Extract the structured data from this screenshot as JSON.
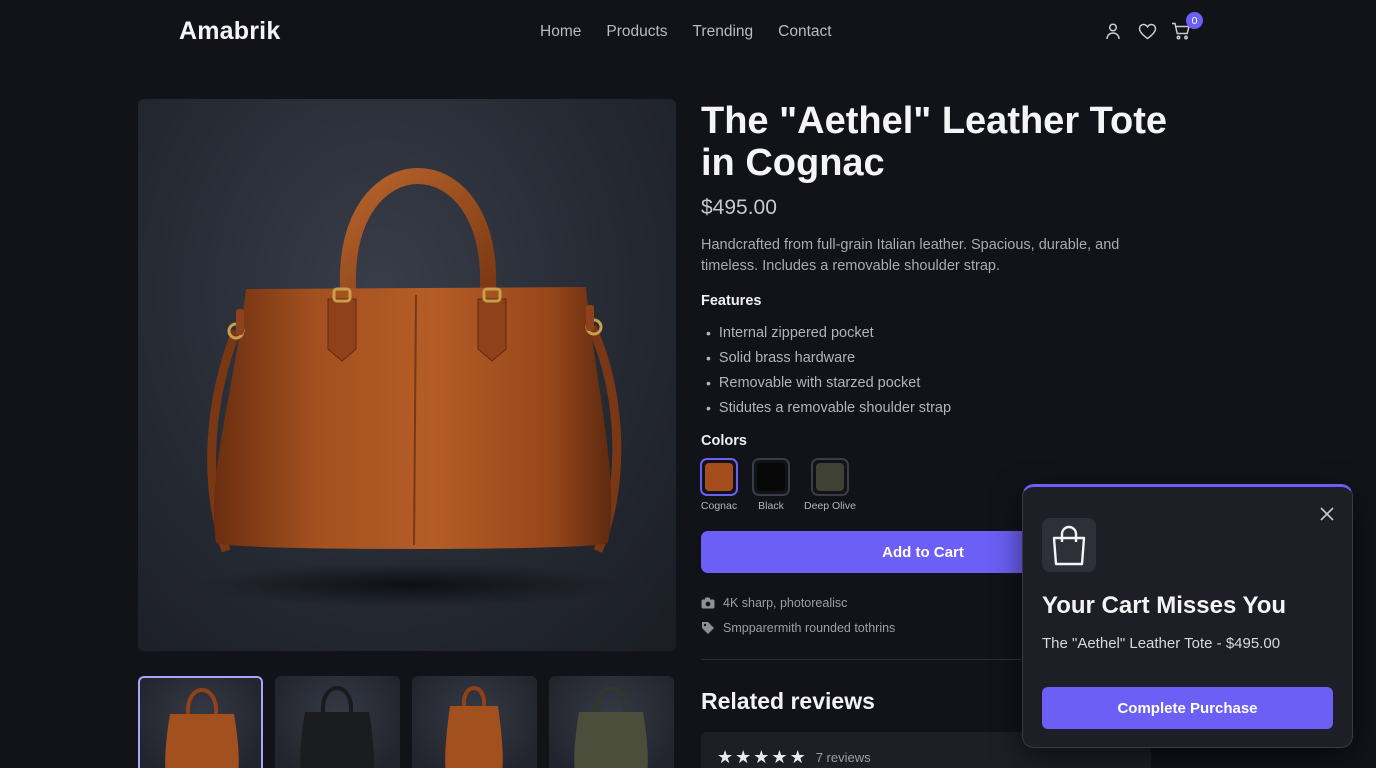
{
  "brand": "Amabrik",
  "nav": [
    "Home",
    "Products",
    "Trending",
    "Contact"
  ],
  "header_icons": [
    "user-icon",
    "heart-icon",
    "cart-icon"
  ],
  "cart_count": "0",
  "product": {
    "title": "The \"Aethel\" Leather Tote in Cognac",
    "price": "$495.00",
    "description": "Handcrafted from full-grain Italian leather. Spacious, durable, and timeless. Includes a removable shoulder strap.",
    "features_heading": "Features",
    "features": [
      "Internal zippered pocket",
      "Solid brass hardware",
      "Removable with starzed pocket",
      "Stidutes a removable shoulder strap"
    ],
    "colors_heading": "Colors",
    "colors": [
      {
        "label": "Cognac",
        "hex": "#a64d1e",
        "selected": true
      },
      {
        "label": "Black",
        "hex": "#080809",
        "selected": false
      },
      {
        "label": "Deep Olive",
        "hex": "#3f4232",
        "selected": false
      }
    ],
    "add_to_cart": "Add to Cart",
    "meta": [
      {
        "icon": "camera-icon",
        "text": "4K sharp, photorealisc"
      },
      {
        "icon": "tag-icon",
        "text": "Smpparermith rounded tothrins"
      }
    ],
    "thumbnails": [
      {
        "color": "cognac",
        "active": true
      },
      {
        "color": "black",
        "active": false
      },
      {
        "color": "cognac",
        "active": false
      },
      {
        "color": "olive",
        "active": false
      }
    ]
  },
  "reviews": {
    "heading": "Related reviews",
    "rating_stars": 5,
    "count_label": "7 reviews"
  },
  "popup": {
    "heading": "Your Cart Misses You",
    "detail": "The \"Aethel\" Leather Tote - $495.00",
    "cta": "Complete Purchase"
  },
  "colors": {
    "accent": "#6b5ff5",
    "background": "#121319",
    "panel": "#1d1e26"
  }
}
